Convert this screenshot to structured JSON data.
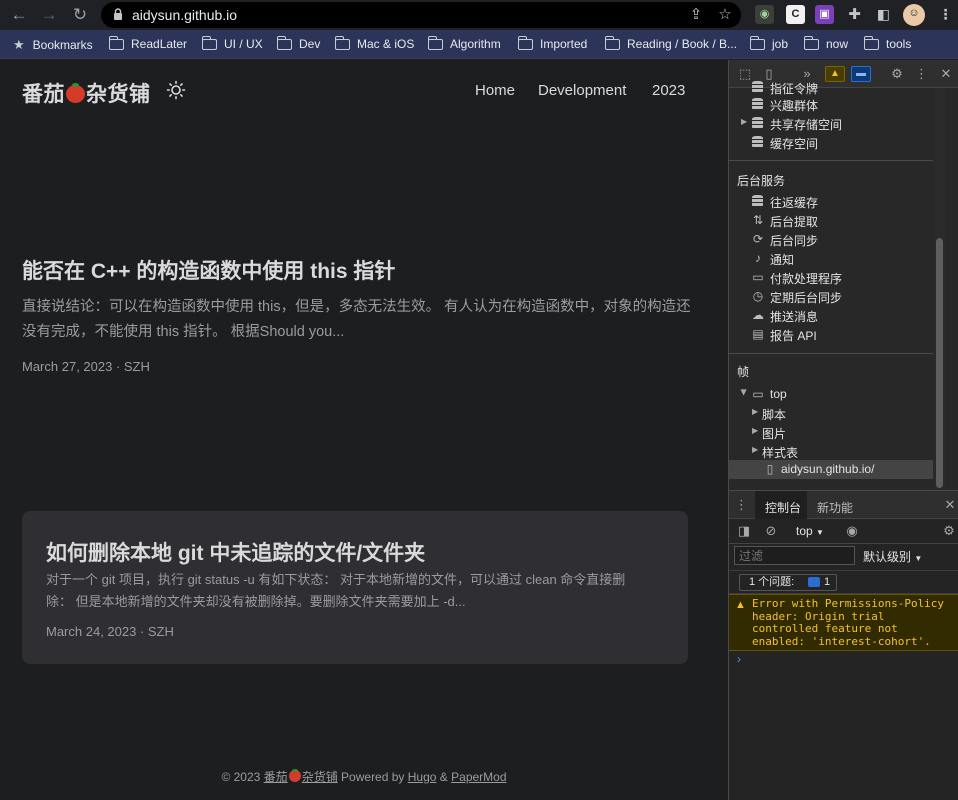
{
  "browser": {
    "url": "aidysun.github.io",
    "bookmarks": [
      {
        "label": "Bookmarks",
        "icon": "star-icon"
      },
      {
        "label": "ReadLater",
        "icon": "folder-icon"
      },
      {
        "label": "UI / UX",
        "icon": "folder-icon"
      },
      {
        "label": "Dev",
        "icon": "folder-icon"
      },
      {
        "label": "Mac & iOS",
        "icon": "folder-icon"
      },
      {
        "label": "Algorithm",
        "icon": "folder-icon"
      },
      {
        "label": "Imported",
        "icon": "folder-icon"
      },
      {
        "label": "Reading / Book / B...",
        "icon": "folder-icon"
      },
      {
        "label": "job",
        "icon": "folder-icon"
      },
      {
        "label": "now",
        "icon": "folder-icon"
      },
      {
        "label": "tools",
        "icon": "folder-icon"
      }
    ],
    "extension_c_letter": "C"
  },
  "site": {
    "logo_left": "番茄",
    "logo_right": "杂货铺",
    "nav": [
      "Home",
      "Development",
      "2023"
    ]
  },
  "posts": [
    {
      "title": "能否在 C++ 的构造函数中使用 this 指针",
      "summary": "直接说结论：可以在构造函数中使用 this，但是，多态无法生效。 有人认为在构造函数中，对象的构造还没有完成，不能使用 this 指针。 根据Should you...",
      "meta": "March 27, 2023 · SZH"
    },
    {
      "title": "如何删除本地 git 中未追踪的文件/文件夹",
      "summary": "对于一个 git 项目，执行 git status -u 有如下状态： 对于本地新增的文件，可以通过 clean 命令直接删除： 但是本地新增的文件夹却没有被删除掉。要删除文件夹需要加上 -d...",
      "meta": "March 24, 2023 · SZH"
    }
  ],
  "footer": {
    "copyright": "© 2023",
    "site_left": "番茄",
    "site_right": "杂货铺",
    "powered_by": "Powered by",
    "hugo": "Hugo",
    "amp": "&",
    "papermod": "PaperMod"
  },
  "devtools": {
    "storage_items": [
      "指征令牌",
      "兴趣群体",
      "共享存储空间",
      "缓存空间"
    ],
    "background_services_heading": "后台服务",
    "background_services": [
      "往返缓存",
      "后台提取",
      "后台同步",
      "通知",
      "付款处理程序",
      "定期后台同步",
      "推送消息",
      "报告 API"
    ],
    "frames_heading": "帧",
    "frame_top": "top",
    "frame_children": [
      "脚本",
      "图片",
      "样式表"
    ],
    "frame_document": "aidysun.github.io/",
    "console": {
      "tab_console": "控制台",
      "tab_whats_new": "新功能",
      "context": "top",
      "filter_placeholder": "过滤",
      "level": "默认级别",
      "issues_label": "1 个问题:",
      "issues_count": "1",
      "warning": "Error with Permissions-Policy header: Origin trial controlled feature not enabled: 'interest-cohort'.",
      "prompt": "›"
    }
  },
  "colors": {
    "page_bg": "#1d1e20",
    "card_bg": "#2e2e33",
    "text_primary": "#dadadb",
    "text_secondary": "#9b9c9d",
    "bookmarks_bg": "#2c3559",
    "warning_bg": "#332b00",
    "warning_text": "#f2c12e"
  }
}
